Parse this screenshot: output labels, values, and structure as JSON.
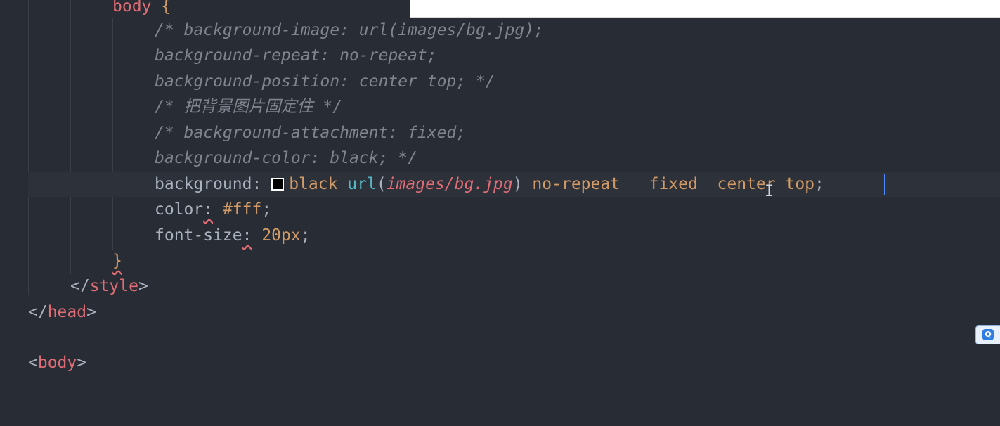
{
  "editor": {
    "lines": {
      "body_open": {
        "selector": "body",
        "brace": " {"
      },
      "c1": "/* background-image: url(images/bg.jpg);",
      "c2": "background-repeat: no-repeat;",
      "c3": "background-position: center top; */",
      "c4": "/* 把背景图片固定住 */",
      "c5": "/* background-attachment: fixed;",
      "c6": "background-color: black; */",
      "bg": {
        "prop": "background",
        "colon": ": ",
        "color": "black",
        "fn": "url",
        "paren_open": "(",
        "path": "images/bg.jpg",
        "paren_close": ")",
        "repeat": " no-repeat",
        "attach": "   fixed",
        "pos": "  center top",
        "semi": ";"
      },
      "color": {
        "prop": "color",
        "colon": ":",
        "value": " #fff",
        "semi": ";"
      },
      "font": {
        "prop": "font-size",
        "colon": ":",
        "value": " 20px",
        "semi": ";"
      },
      "close_brace": "}",
      "style_close": {
        "open": "</",
        "name": "style",
        "close": ">"
      },
      "head_close": {
        "open": "</",
        "name": "head",
        "close": ">"
      },
      "body_tag": {
        "open": "<",
        "name": "body",
        "close": ">"
      }
    },
    "swatch_color": "#000000",
    "accent": "#528bff"
  },
  "taskbar": {
    "tray_icon": "search-tray-icon",
    "tray_label": "Q"
  }
}
